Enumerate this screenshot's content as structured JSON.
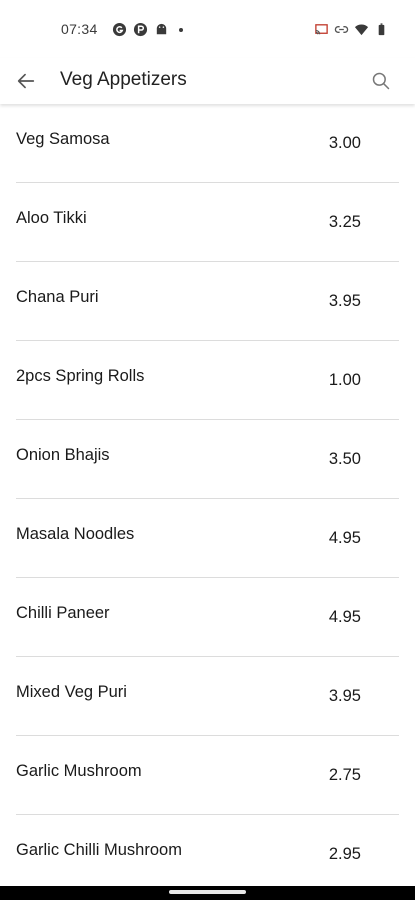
{
  "status_bar": {
    "time": "07:34",
    "left_icons": [
      "circle-g-icon",
      "circle-p-icon",
      "android-icon",
      "dot-icon"
    ],
    "right_icons": [
      "cast-icon",
      "link-icon",
      "wifi-icon",
      "battery-icon"
    ]
  },
  "app_bar": {
    "title": "Veg Appetizers",
    "back_icon": "arrow-left-icon",
    "search_icon": "search-icon"
  },
  "menu": {
    "items": [
      {
        "name": "Veg Samosa",
        "price": "3.00"
      },
      {
        "name": "Aloo Tikki",
        "price": "3.25"
      },
      {
        "name": "Chana Puri",
        "price": "3.95"
      },
      {
        "name": "2pcs Spring Rolls",
        "price": "1.00"
      },
      {
        "name": "Onion Bhajis",
        "price": "3.50"
      },
      {
        "name": "Masala Noodles",
        "price": "4.95"
      },
      {
        "name": "Chilli Paneer",
        "price": "4.95"
      },
      {
        "name": "Mixed Veg Puri",
        "price": "3.95"
      },
      {
        "name": "Garlic Mushroom",
        "price": "2.75"
      },
      {
        "name": "Garlic Chilli Mushroom",
        "price": "2.95"
      }
    ]
  },
  "colors": {
    "text": "#1a1a1a",
    "divider": "#dcdcdc",
    "icon": "#555555",
    "background": "#ffffff"
  }
}
